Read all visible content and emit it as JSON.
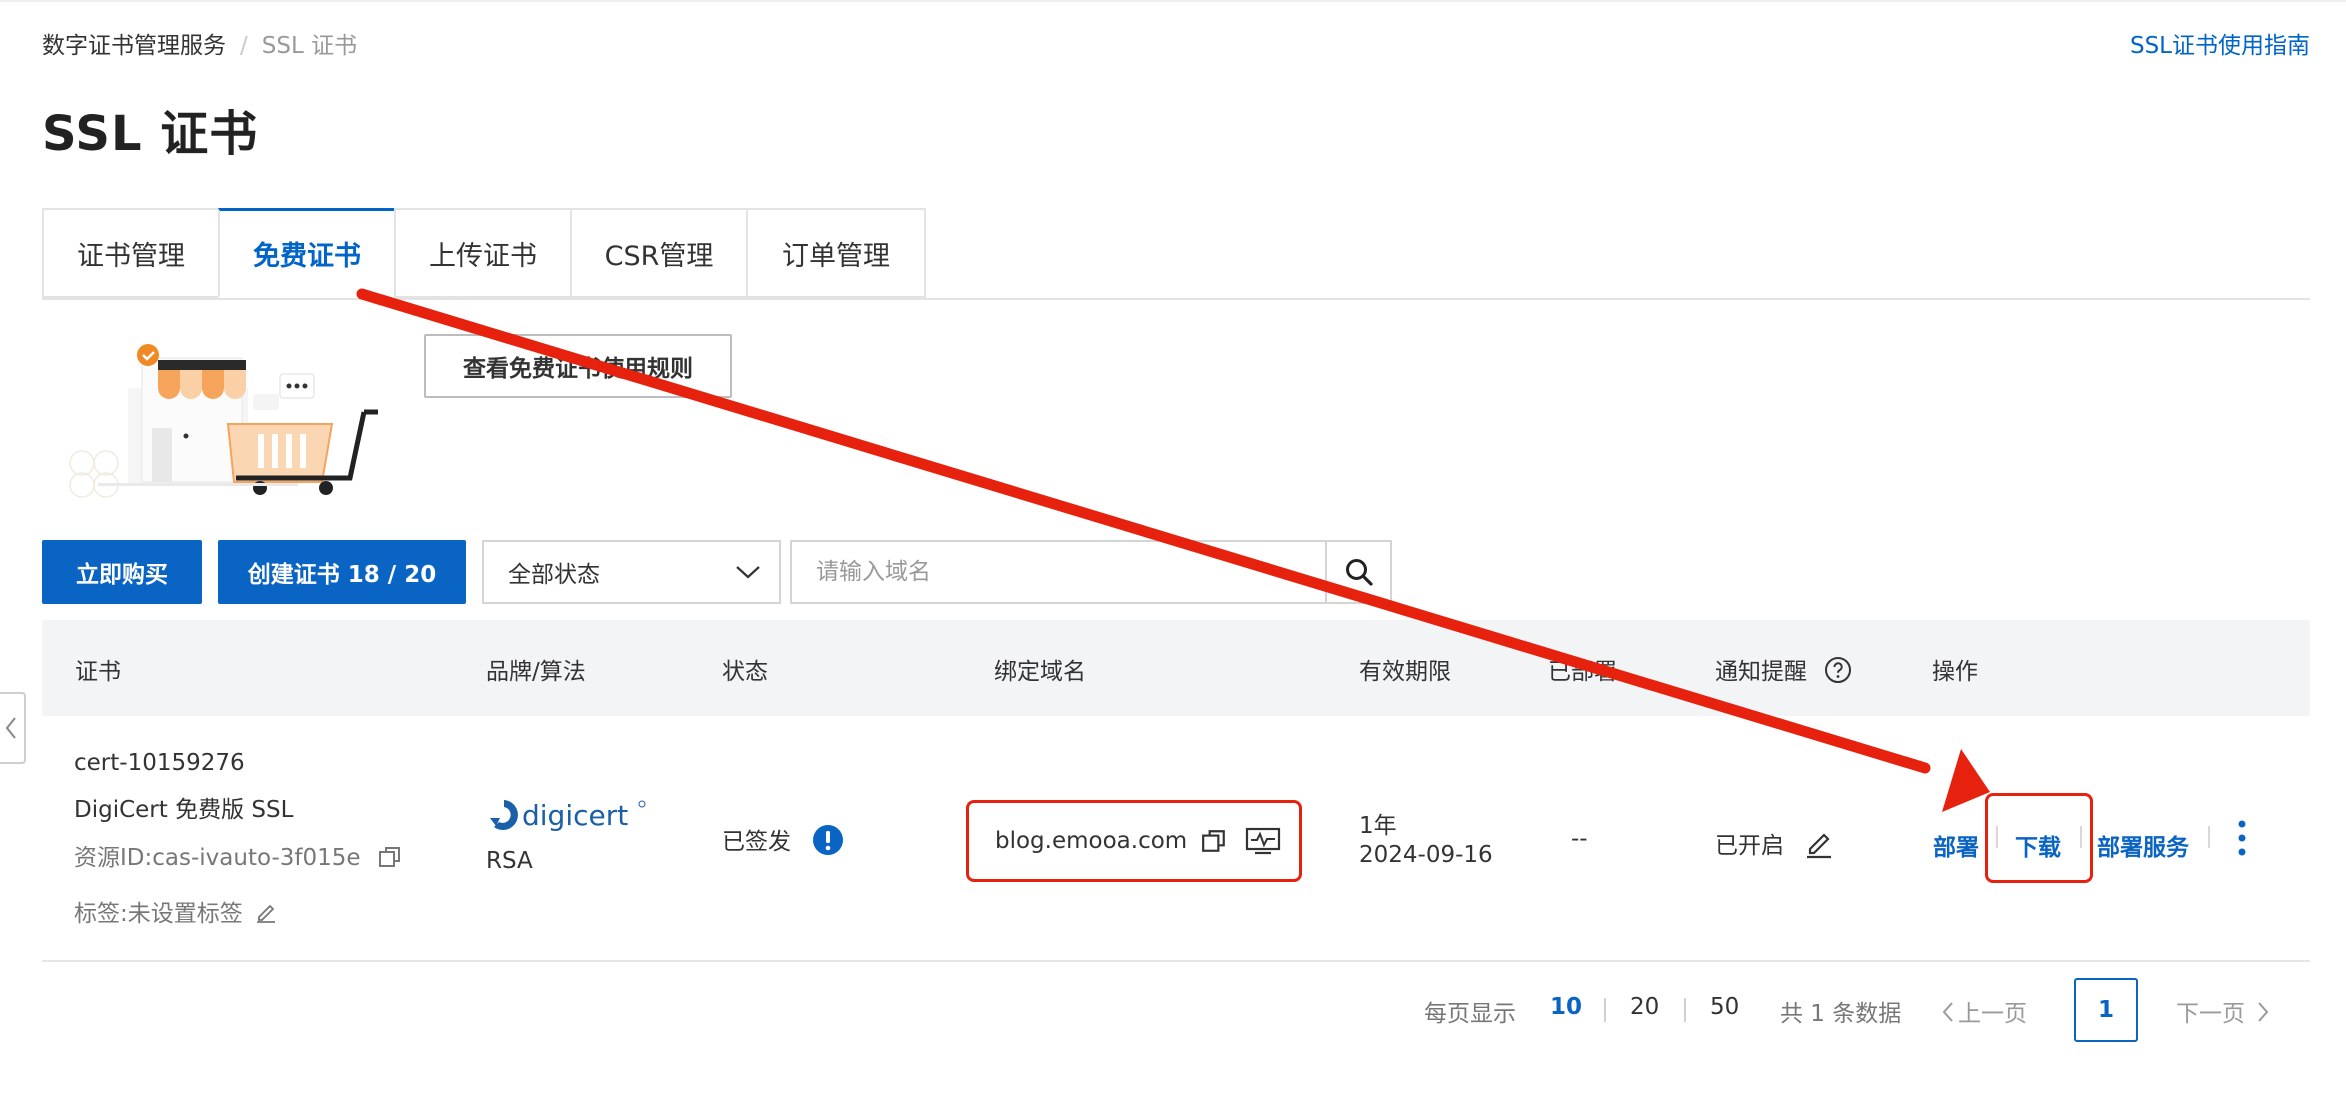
{
  "breadcrumb": {
    "root": "数字证书管理服务",
    "separator": "/",
    "current": "SSL 证书"
  },
  "guide_link": "SSL证书使用指南",
  "page_title": "SSL 证书",
  "tabs": [
    {
      "label": "证书管理",
      "active": false
    },
    {
      "label": "免费证书",
      "active": true
    },
    {
      "label": "上传证书",
      "active": false
    },
    {
      "label": "CSR管理",
      "active": false
    },
    {
      "label": "订单管理",
      "active": false
    }
  ],
  "rules_button": "查看免费证书使用规则",
  "toolbar": {
    "buy_label": "立即购买",
    "create_label": "创建证书 18 / 20",
    "status_select_value": "全部状态",
    "search_placeholder": "请输入域名"
  },
  "table": {
    "headers": {
      "cert": "证书",
      "brand": "品牌/算法",
      "status": "状态",
      "domain": "绑定域名",
      "validity": "有效期限",
      "deployed": "已部署",
      "notify": "通知提醒",
      "actions": "操作"
    },
    "rows": [
      {
        "cert_name": "cert-10159276",
        "cert_type": "DigiCert 免费版 SSL",
        "resource_id": "资源ID:cas-ivauto-3f015e",
        "tags": "标签:未设置标签",
        "brand_logo": "digicert",
        "algorithm": "RSA",
        "status": "已签发",
        "domain": "blog.emooa.com",
        "validity_period": "1年",
        "validity_date": "2024-09-16",
        "deployed": "--",
        "notify": "已开启",
        "actions": {
          "deploy": "部署",
          "download": "下载",
          "deploy_service": "部署服务"
        }
      }
    ]
  },
  "pagination": {
    "per_page_label": "每页显示",
    "sizes": [
      "10",
      "20",
      "50"
    ],
    "active_size": "10",
    "total": "共 1 条数据",
    "prev": "上一页",
    "current_page": "1",
    "next": "下一页"
  },
  "colors": {
    "primary": "#0a64c3",
    "annotation_red": "#e6220f",
    "header_bg": "#f3f4f6"
  },
  "icons": [
    "copy-icon",
    "monitor-icon",
    "info-icon",
    "question-icon",
    "edit-icon",
    "more-icon",
    "search-icon",
    "chevron-down-icon",
    "chevron-left-icon"
  ]
}
